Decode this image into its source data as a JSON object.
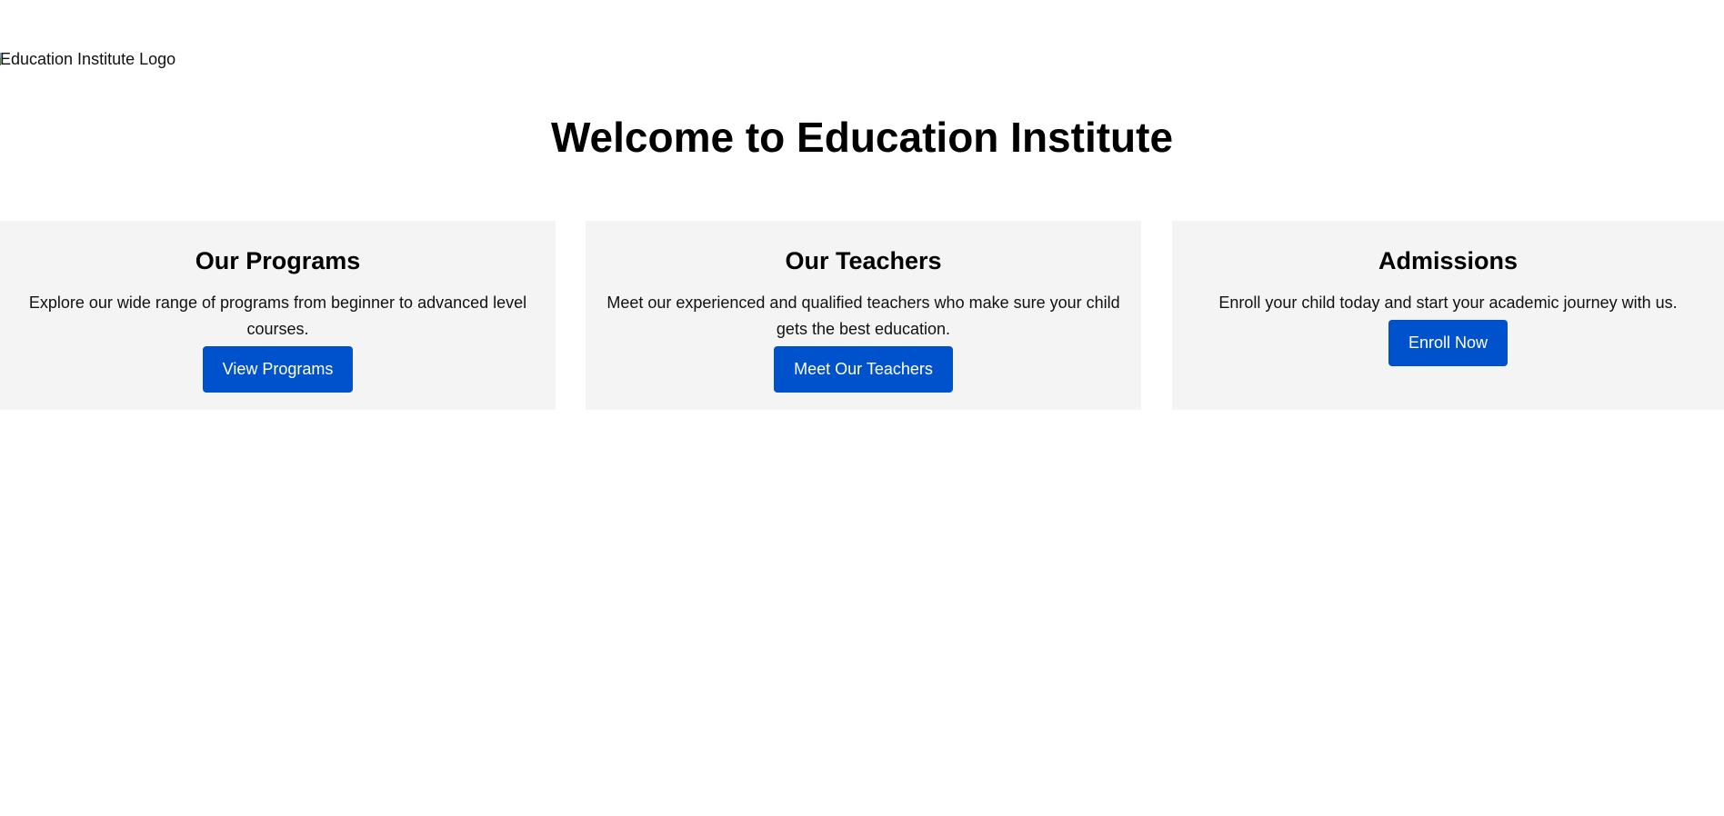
{
  "logo": {
    "alt_text": "Education Institute Logo"
  },
  "header": {
    "title": "Welcome to Education Institute"
  },
  "cards": [
    {
      "title": "Our Programs",
      "description": "Explore our wide range of programs from beginner to advanced level courses.",
      "button_label": "View Programs"
    },
    {
      "title": "Our Teachers",
      "description": "Meet our experienced and qualified teachers who make sure your child gets the best education.",
      "button_label": "Meet Our Teachers"
    },
    {
      "title": "Admissions",
      "description": "Enroll your child today and start your academic journey with us.",
      "button_label": "Enroll Now"
    }
  ],
  "colors": {
    "button_background": "#0052cc",
    "card_background": "#f4f4f4"
  }
}
